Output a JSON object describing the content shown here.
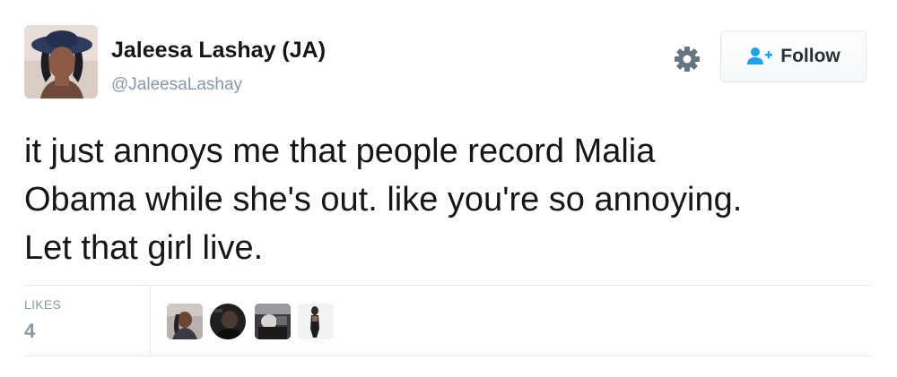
{
  "tweet": {
    "author_name": "Jaleesa Lashay (JA)",
    "author_handle": "@JaleesaLashay",
    "text": "it just annoys me that people record Malia\nObama while she's out. like you're so annoying.\nLet that girl live.",
    "actions": {
      "settings_icon": "gear-icon",
      "follow_label": "Follow",
      "follow_icon": "follow-person-icon",
      "accent_color": "#1da1f2"
    },
    "likes": {
      "label": "LIKES",
      "count": "4",
      "avatars": [
        "liker-avatar-1",
        "liker-avatar-2",
        "liker-avatar-3",
        "liker-avatar-4"
      ]
    }
  }
}
